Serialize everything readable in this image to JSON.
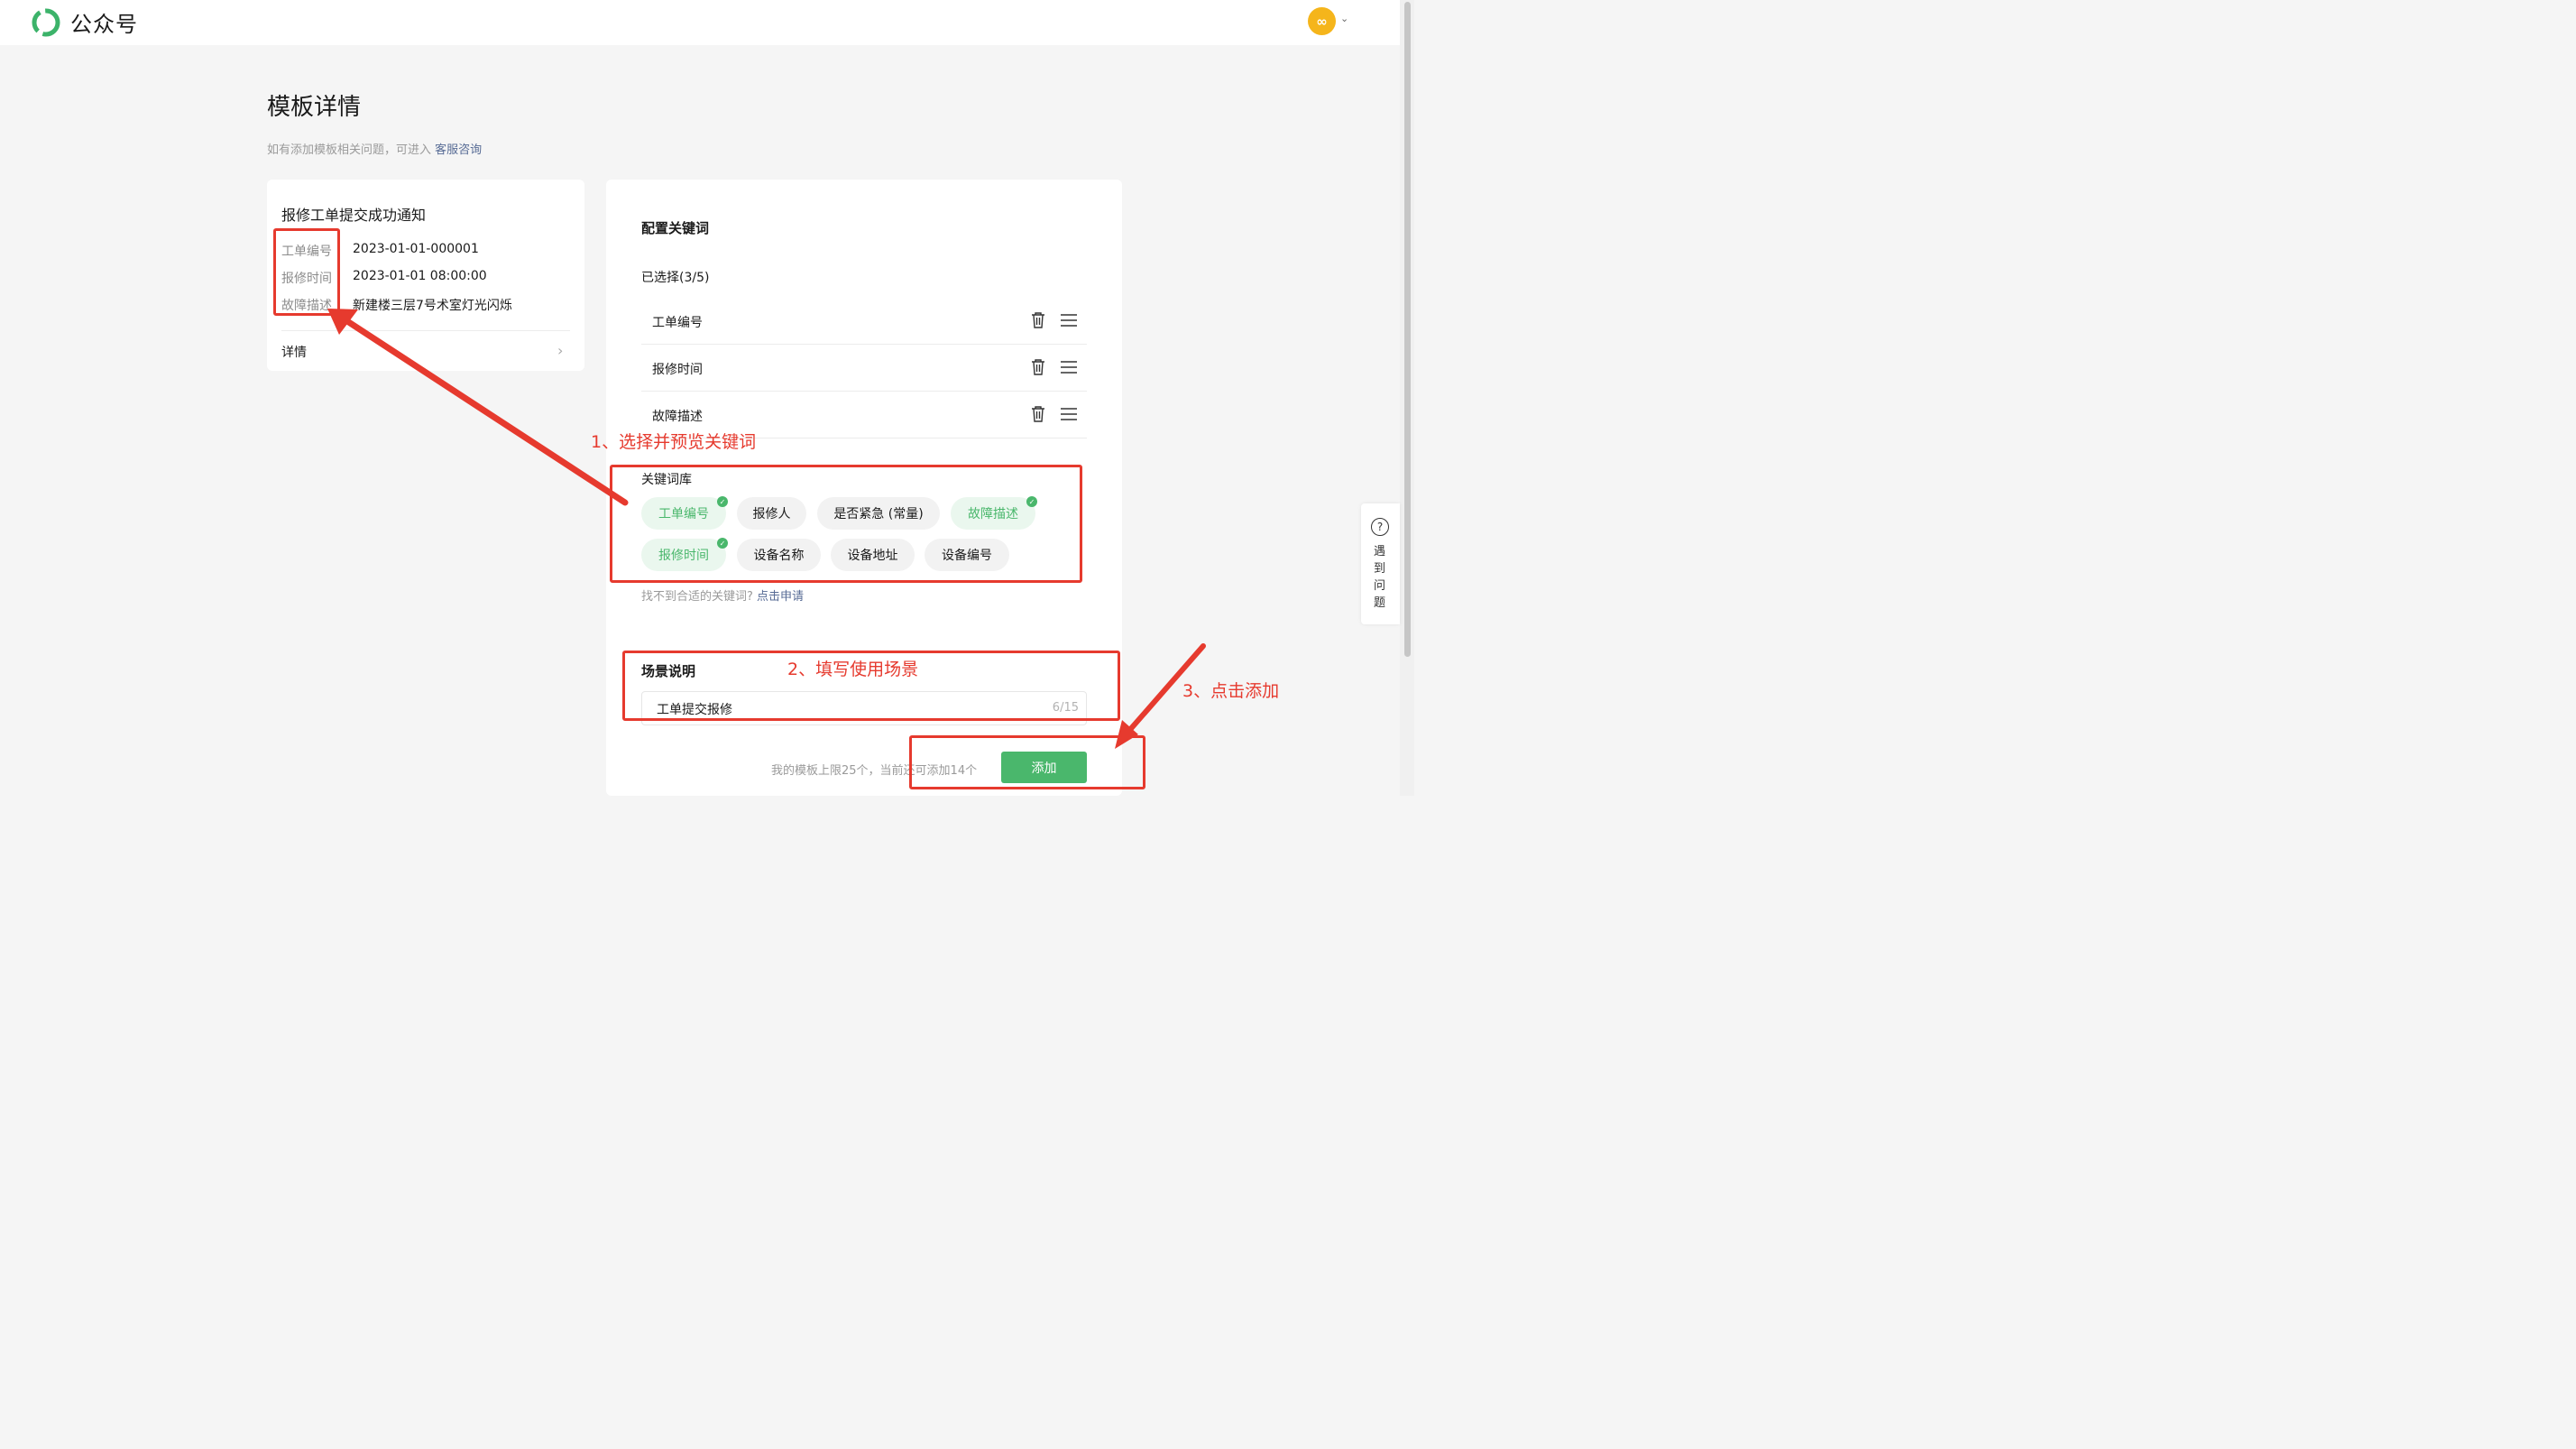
{
  "header": {
    "brand": "公众号",
    "avatar_glyph": "∞",
    "caret": "⌄"
  },
  "page": {
    "title": "模板详情",
    "hint_prefix": "如有添加模板相关问题，可进入",
    "hint_link": "客服咨询"
  },
  "preview": {
    "title": "报修工单提交成功通知",
    "rows": [
      {
        "label": "工单编号",
        "value": "2023-01-01-000001"
      },
      {
        "label": "报修时间",
        "value": "2023-01-01 08:00:00"
      },
      {
        "label": "故障描述",
        "value": "新建楼三层7号术室灯光闪烁"
      }
    ],
    "detail_label": "详情",
    "chevron": "›"
  },
  "config": {
    "title": "配置关键词",
    "selected_count": "已选择(3/5)",
    "selected": [
      "工单编号",
      "报修时间",
      "故障描述"
    ],
    "library_title": "关键词库",
    "library": [
      {
        "label": "工单编号",
        "selected": true
      },
      {
        "label": "报修人",
        "selected": false
      },
      {
        "label": "是否紧急 (常量)",
        "selected": false
      },
      {
        "label": "故障描述",
        "selected": true
      },
      {
        "label": "报修时间",
        "selected": true
      },
      {
        "label": "设备名称",
        "selected": false
      },
      {
        "label": "设备地址",
        "selected": false
      },
      {
        "label": "设备编号",
        "selected": false
      }
    ],
    "apply_prefix": "找不到合适的关键词?",
    "apply_link": "点击申请"
  },
  "scene": {
    "title": "场景说明",
    "value": "工单提交报修",
    "counter": "6/15"
  },
  "footer": {
    "limit_text": "我的模板上限25个，当前还可添加14个",
    "add_label": "添加"
  },
  "annotations": {
    "note1": "1、选择并预览关键词",
    "note2": "2、填写使用场景",
    "note3": "3、点击添加",
    "accent": "#e63a2e"
  },
  "help": {
    "glyph": "?",
    "label": "遇到问题"
  },
  "colors": {
    "brand_green": "#4ab76c",
    "link": "#576b95",
    "avatar": "#f5b51b"
  }
}
